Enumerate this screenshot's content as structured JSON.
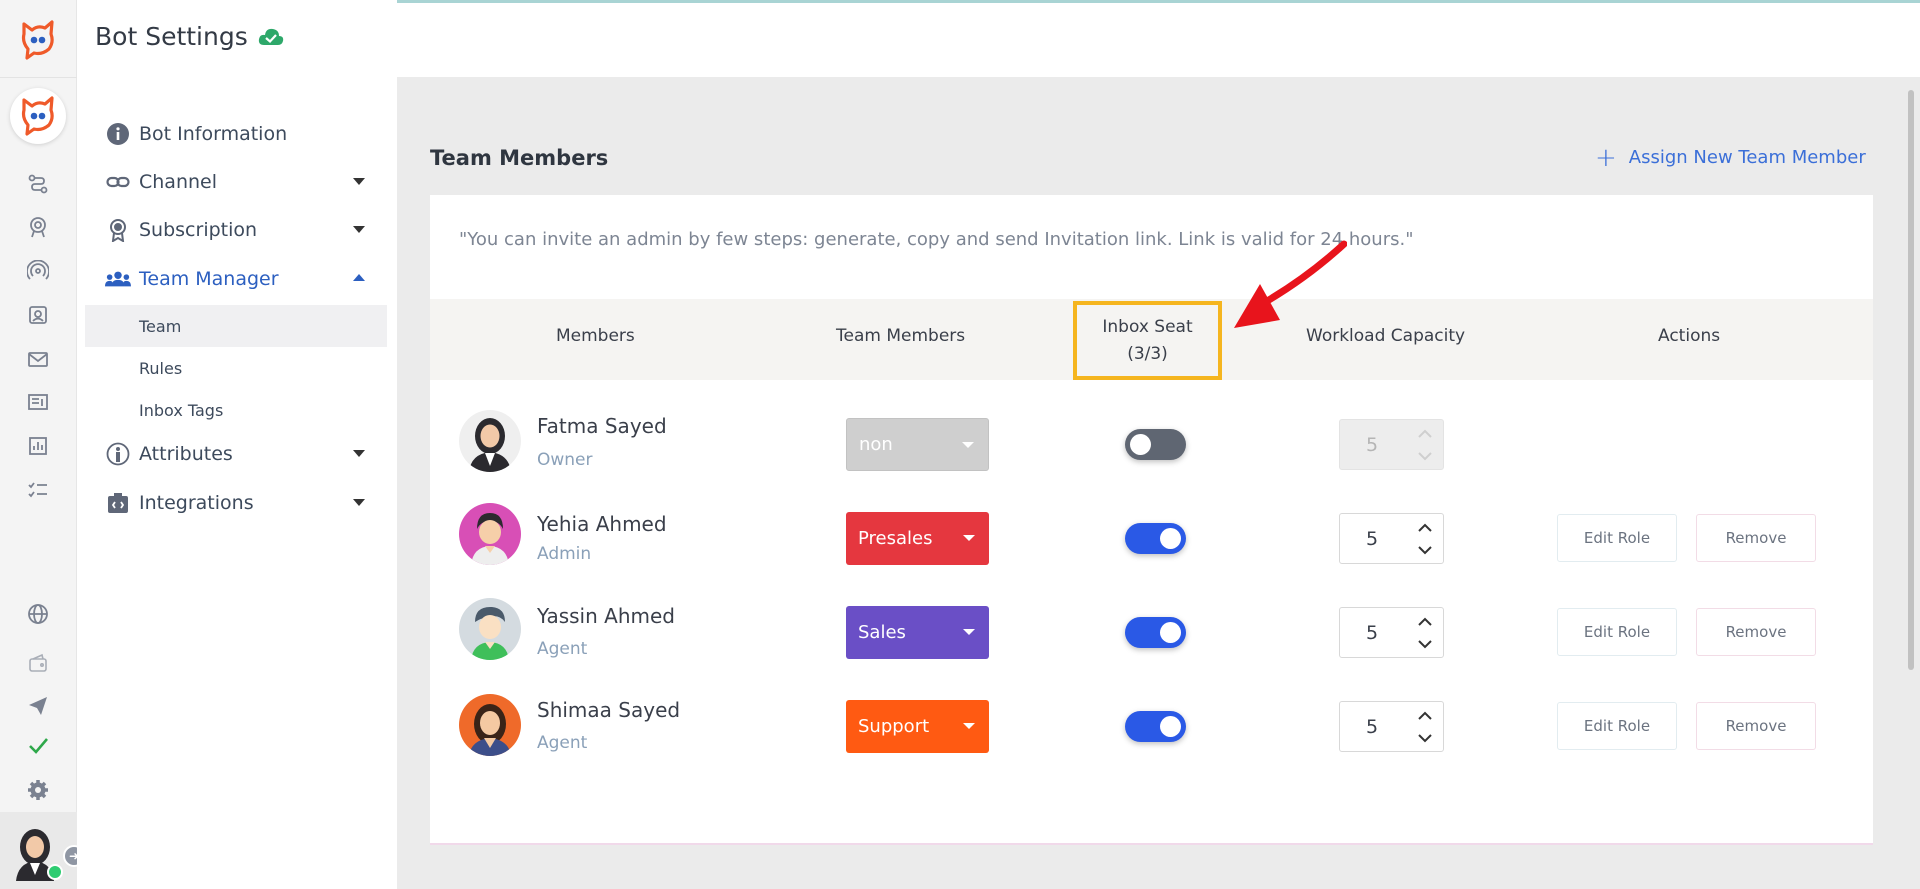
{
  "page": {
    "title": "Bot Settings"
  },
  "sidebar": {
    "items": [
      {
        "label": "Bot Information"
      },
      {
        "label": "Channel"
      },
      {
        "label": "Subscription"
      },
      {
        "label": "Team Manager"
      },
      {
        "label": "Attributes"
      },
      {
        "label": "Integrations"
      }
    ],
    "sub_items": [
      {
        "label": "Team"
      },
      {
        "label": "Rules"
      },
      {
        "label": "Inbox Tags"
      }
    ]
  },
  "main": {
    "section_title": "Team Members",
    "assign_label": "Assign New Team Member",
    "note": "\"You can invite an admin by few steps: generate, copy and send Invitation link. Link is valid for 24 hours.\"",
    "table": {
      "headers": {
        "members": "Members",
        "team_members": "Team Members",
        "inbox_seat": "Inbox Seat",
        "inbox_seat_count": "(3/3)",
        "workload": "Workload Capacity",
        "actions": "Actions"
      },
      "rows": [
        {
          "name": "Fatma Sayed",
          "role": "Owner",
          "team": "non",
          "team_color": "#cfcfcf",
          "inbox_seat_on": false,
          "capacity": "5",
          "edit_label": "",
          "remove_label": ""
        },
        {
          "name": "Yehia Ahmed",
          "role": "Admin",
          "team": "Presales",
          "team_color": "#e5373f",
          "inbox_seat_on": true,
          "capacity": "5",
          "edit_label": "Edit Role",
          "remove_label": "Remove"
        },
        {
          "name": "Yassin Ahmed",
          "role": "Agent",
          "team": "Sales",
          "team_color": "#6a4fc6",
          "inbox_seat_on": true,
          "capacity": "5",
          "edit_label": "Edit Role",
          "remove_label": "Remove"
        },
        {
          "name": "Shimaa Sayed",
          "role": "Agent",
          "team": "Support",
          "team_color": "#ff5a12",
          "inbox_seat_on": true,
          "capacity": "5",
          "edit_label": "Edit Role",
          "remove_label": "Remove"
        }
      ]
    }
  },
  "colors": {
    "accent": "#2c5fc0",
    "link": "#3b6fd8",
    "toggle_on": "#2a59e6",
    "toggle_off": "#5f6672",
    "highlight": "#f5b51f",
    "annotation": "#e8141c"
  }
}
